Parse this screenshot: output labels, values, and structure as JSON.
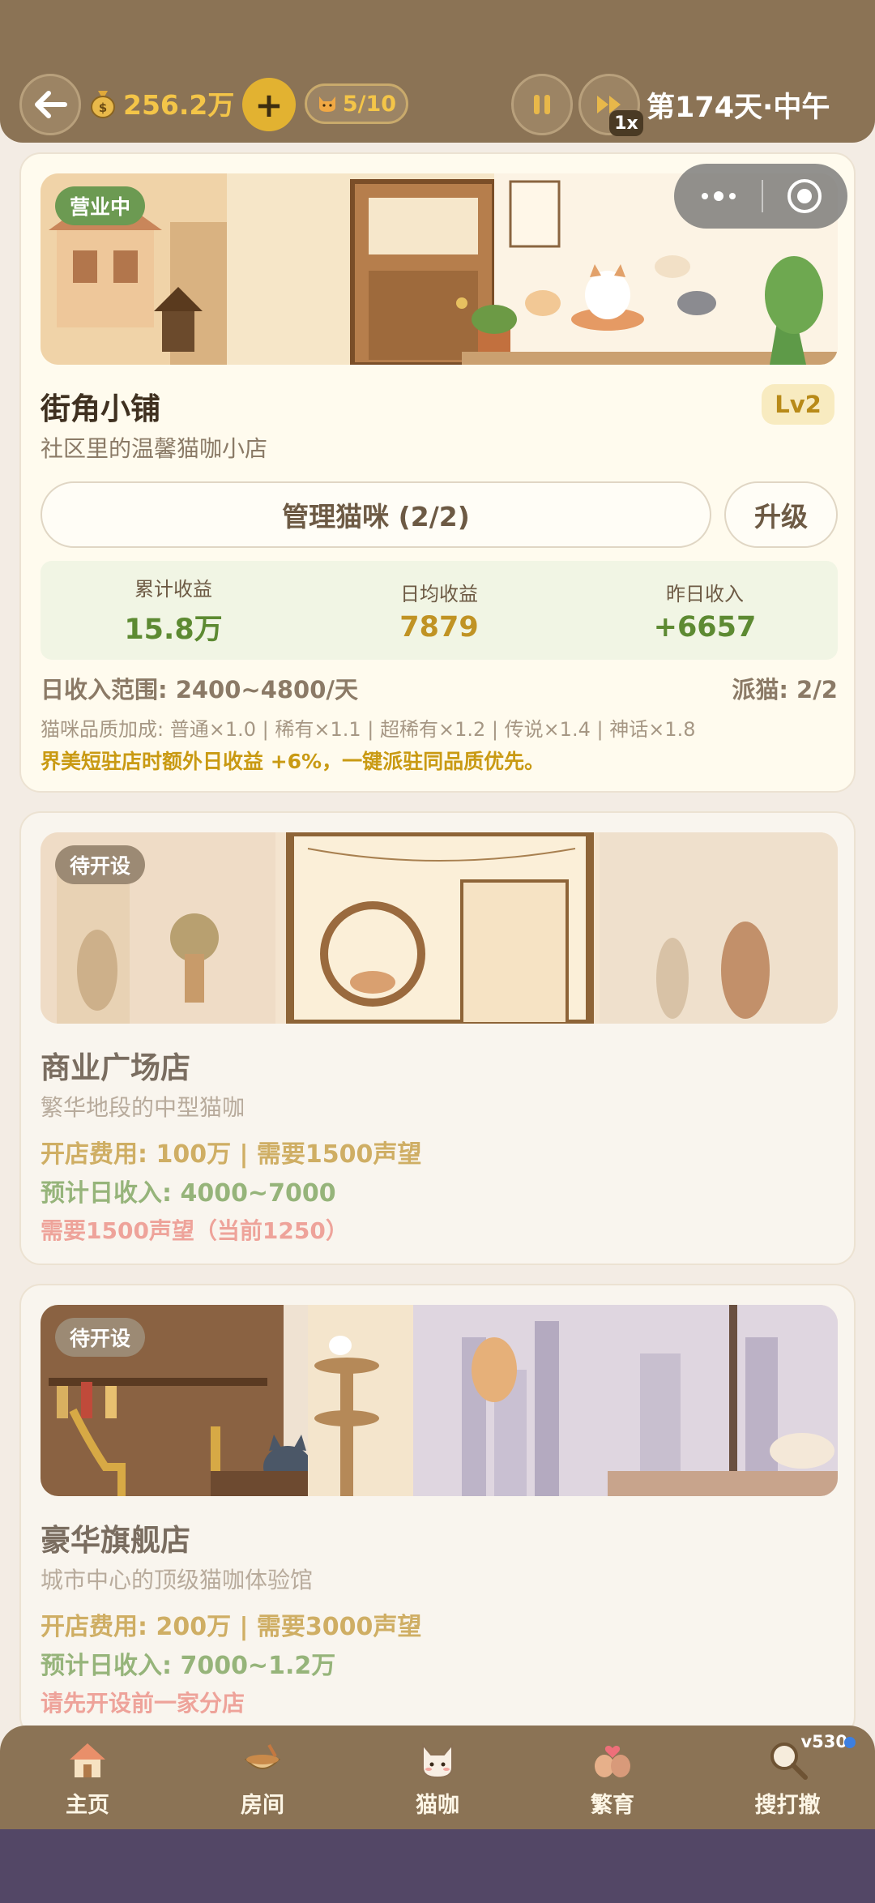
{
  "header": {
    "money": "256.2万",
    "cat_count": "5/10",
    "speed": "1x",
    "day": "第174天·中午"
  },
  "shops": [
    {
      "status": "营业中",
      "name": "街角小铺",
      "desc": "社区里的温馨猫咖小店",
      "level": "Lv2",
      "manage_label": "管理猫咪 (2/2)",
      "upgrade_label": "升级",
      "stats": [
        {
          "label": "累计收益",
          "value": "15.8万",
          "color": "#5d8a32"
        },
        {
          "label": "日均收益",
          "value": "7879",
          "color": "#c09324"
        },
        {
          "label": "昨日收入",
          "value": "+6657",
          "color": "#5d8a32"
        }
      ],
      "range": "日收入范围: 2400~4800/天",
      "dispatch": "派猫: 2/2",
      "quality": "猫咪品质加成: 普通×1.0 | 稀有×1.1 | 超稀有×1.2 | 传说×1.4 | 神话×1.8",
      "bonus": "界美短驻店时额外日收益 +6%，一键派驻同品质优先。"
    },
    {
      "status": "待开设",
      "name": "商业广场店",
      "desc": "繁华地段的中型猫咖",
      "fee": "开店费用: 100万 | 需要1500声望",
      "income": "预计日收入: 4000~7000",
      "warning": "需要1500声望（当前1250）"
    },
    {
      "status": "待开设",
      "name": "豪华旗舰店",
      "desc": "城市中心的顶级猫咖体验馆",
      "fee": "开店费用: 200万 | 需要3000声望",
      "income": "预计日收入: 7000~1.2万",
      "warning": "请先开设前一家分店"
    }
  ],
  "nav": {
    "items": [
      {
        "label": "主页",
        "icon": "house-icon"
      },
      {
        "label": "房间",
        "icon": "bowl-icon"
      },
      {
        "label": "猫咖",
        "icon": "cat-face-icon"
      },
      {
        "label": "繁育",
        "icon": "cats-heart-icon"
      },
      {
        "label": "搜打撤",
        "icon": "magnifier-icon"
      }
    ],
    "version": "v530"
  },
  "colors": {
    "topbar": "#8b7355",
    "gold": "#f4c548",
    "open_green": "#6c9a52"
  }
}
